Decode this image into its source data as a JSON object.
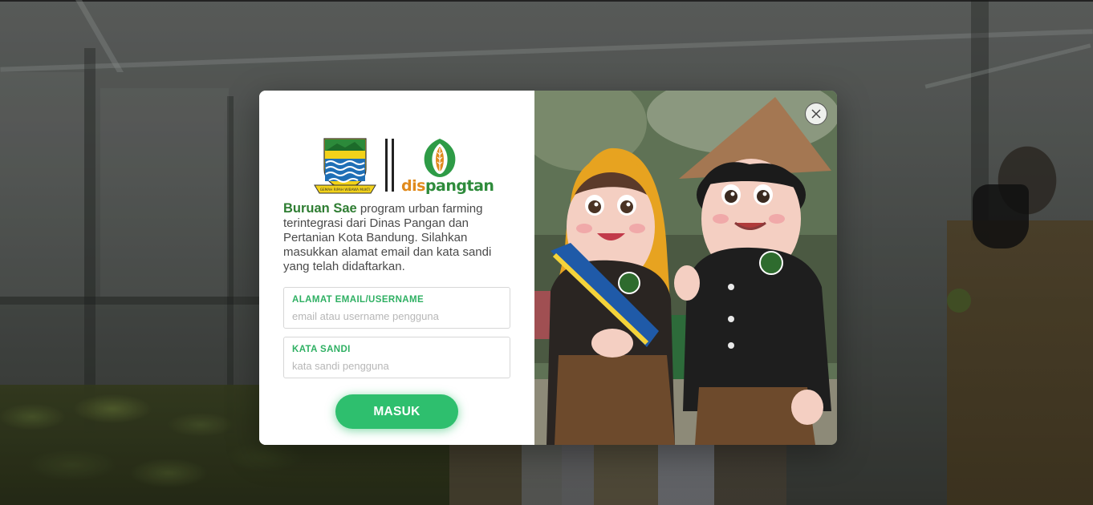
{
  "login_modal": {
    "logos": {
      "city_crest_motto": "GEMAH RIPAH WIBAWA MUKTI",
      "dispangtan_part1": "dis",
      "dispangtan_part2": "pangtan"
    },
    "description": {
      "brand": "Buruan Sae",
      "text": " program urban farming terintegrasi dari Dinas Pangan dan Pertanian Kota Bandung. Silahkan masukkan alamat email dan kata sandi yang telah didaftarkan."
    },
    "email_field": {
      "label": "ALAMAT EMAIL/USERNAME",
      "placeholder": "email atau username pengguna",
      "value": ""
    },
    "password_field": {
      "label": "KATA SANDI",
      "placeholder": "kata sandi pengguna",
      "value": ""
    },
    "submit_label": "MASUK",
    "close_icon": "close-icon"
  },
  "colors": {
    "brand_green": "#2ebf6e",
    "label_green": "#2fb063",
    "brand_dark_green": "#2e7d32",
    "dispangtan_orange": "#e08a1c"
  }
}
